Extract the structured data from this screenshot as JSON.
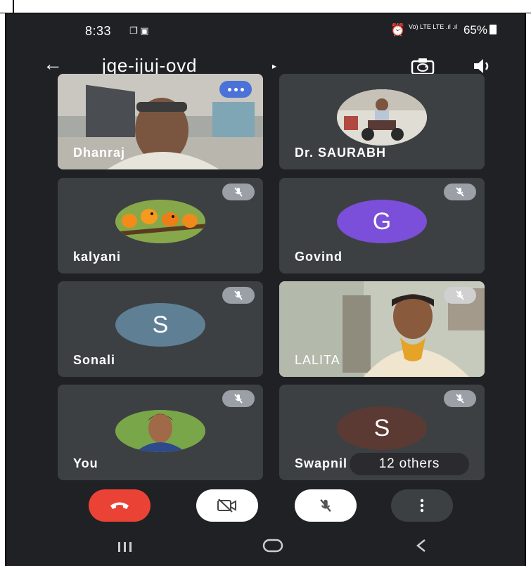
{
  "status_bar": {
    "time": "8:33",
    "left_icons": "❐ ▣",
    "signal": "Vo) LTE LTE .ıl .ıl",
    "battery": "65%"
  },
  "app_bar": {
    "meeting_code": "jqe-ijuj-ovd",
    "back_icon": "←",
    "caret": "▸"
  },
  "tiles": [
    {
      "name": "Dhanraj",
      "type": "video",
      "muted": false,
      "menu": true
    },
    {
      "name": "Dr. SAURABH",
      "type": "photo",
      "muted": false
    },
    {
      "name": "kalyani",
      "type": "photo",
      "muted": true
    },
    {
      "name": "Govind",
      "type": "initial",
      "initial": "G",
      "color": "#7b4fd9",
      "muted": true
    },
    {
      "name": "Sonali",
      "type": "initial",
      "initial": "S",
      "color": "#5f7f95",
      "muted": true
    },
    {
      "name": "LALITA",
      "type": "video",
      "muted": true
    },
    {
      "name": "You",
      "type": "photo",
      "muted": true
    },
    {
      "name": "Swapnil",
      "type": "initial",
      "initial": "S",
      "color": "#5b3a33",
      "muted": true,
      "others_label": "12 others"
    }
  ],
  "colors": {
    "background": "#202124",
    "tile": "#3c4043",
    "end_call": "#ea4335",
    "more_button": "#3c4043"
  }
}
